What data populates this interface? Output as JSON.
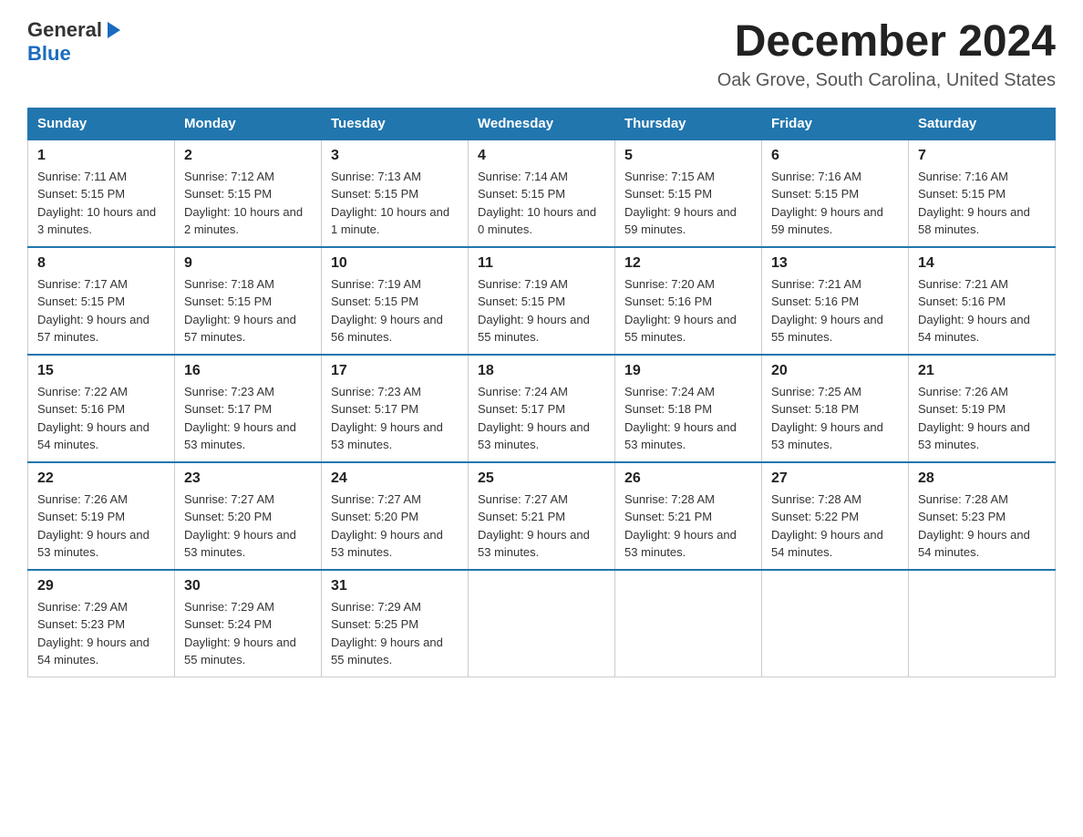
{
  "header": {
    "logo_general": "General",
    "logo_blue": "Blue",
    "month_title": "December 2024",
    "location": "Oak Grove, South Carolina, United States"
  },
  "weekdays": [
    "Sunday",
    "Monday",
    "Tuesday",
    "Wednesday",
    "Thursday",
    "Friday",
    "Saturday"
  ],
  "weeks": [
    [
      {
        "day": "1",
        "sunrise": "7:11 AM",
        "sunset": "5:15 PM",
        "daylight": "10 hours and 3 minutes."
      },
      {
        "day": "2",
        "sunrise": "7:12 AM",
        "sunset": "5:15 PM",
        "daylight": "10 hours and 2 minutes."
      },
      {
        "day": "3",
        "sunrise": "7:13 AM",
        "sunset": "5:15 PM",
        "daylight": "10 hours and 1 minute."
      },
      {
        "day": "4",
        "sunrise": "7:14 AM",
        "sunset": "5:15 PM",
        "daylight": "10 hours and 0 minutes."
      },
      {
        "day": "5",
        "sunrise": "7:15 AM",
        "sunset": "5:15 PM",
        "daylight": "9 hours and 59 minutes."
      },
      {
        "day": "6",
        "sunrise": "7:16 AM",
        "sunset": "5:15 PM",
        "daylight": "9 hours and 59 minutes."
      },
      {
        "day": "7",
        "sunrise": "7:16 AM",
        "sunset": "5:15 PM",
        "daylight": "9 hours and 58 minutes."
      }
    ],
    [
      {
        "day": "8",
        "sunrise": "7:17 AM",
        "sunset": "5:15 PM",
        "daylight": "9 hours and 57 minutes."
      },
      {
        "day": "9",
        "sunrise": "7:18 AM",
        "sunset": "5:15 PM",
        "daylight": "9 hours and 57 minutes."
      },
      {
        "day": "10",
        "sunrise": "7:19 AM",
        "sunset": "5:15 PM",
        "daylight": "9 hours and 56 minutes."
      },
      {
        "day": "11",
        "sunrise": "7:19 AM",
        "sunset": "5:15 PM",
        "daylight": "9 hours and 55 minutes."
      },
      {
        "day": "12",
        "sunrise": "7:20 AM",
        "sunset": "5:16 PM",
        "daylight": "9 hours and 55 minutes."
      },
      {
        "day": "13",
        "sunrise": "7:21 AM",
        "sunset": "5:16 PM",
        "daylight": "9 hours and 55 minutes."
      },
      {
        "day": "14",
        "sunrise": "7:21 AM",
        "sunset": "5:16 PM",
        "daylight": "9 hours and 54 minutes."
      }
    ],
    [
      {
        "day": "15",
        "sunrise": "7:22 AM",
        "sunset": "5:16 PM",
        "daylight": "9 hours and 54 minutes."
      },
      {
        "day": "16",
        "sunrise": "7:23 AM",
        "sunset": "5:17 PM",
        "daylight": "9 hours and 53 minutes."
      },
      {
        "day": "17",
        "sunrise": "7:23 AM",
        "sunset": "5:17 PM",
        "daylight": "9 hours and 53 minutes."
      },
      {
        "day": "18",
        "sunrise": "7:24 AM",
        "sunset": "5:17 PM",
        "daylight": "9 hours and 53 minutes."
      },
      {
        "day": "19",
        "sunrise": "7:24 AM",
        "sunset": "5:18 PM",
        "daylight": "9 hours and 53 minutes."
      },
      {
        "day": "20",
        "sunrise": "7:25 AM",
        "sunset": "5:18 PM",
        "daylight": "9 hours and 53 minutes."
      },
      {
        "day": "21",
        "sunrise": "7:26 AM",
        "sunset": "5:19 PM",
        "daylight": "9 hours and 53 minutes."
      }
    ],
    [
      {
        "day": "22",
        "sunrise": "7:26 AM",
        "sunset": "5:19 PM",
        "daylight": "9 hours and 53 minutes."
      },
      {
        "day": "23",
        "sunrise": "7:27 AM",
        "sunset": "5:20 PM",
        "daylight": "9 hours and 53 minutes."
      },
      {
        "day": "24",
        "sunrise": "7:27 AM",
        "sunset": "5:20 PM",
        "daylight": "9 hours and 53 minutes."
      },
      {
        "day": "25",
        "sunrise": "7:27 AM",
        "sunset": "5:21 PM",
        "daylight": "9 hours and 53 minutes."
      },
      {
        "day": "26",
        "sunrise": "7:28 AM",
        "sunset": "5:21 PM",
        "daylight": "9 hours and 53 minutes."
      },
      {
        "day": "27",
        "sunrise": "7:28 AM",
        "sunset": "5:22 PM",
        "daylight": "9 hours and 54 minutes."
      },
      {
        "day": "28",
        "sunrise": "7:28 AM",
        "sunset": "5:23 PM",
        "daylight": "9 hours and 54 minutes."
      }
    ],
    [
      {
        "day": "29",
        "sunrise": "7:29 AM",
        "sunset": "5:23 PM",
        "daylight": "9 hours and 54 minutes."
      },
      {
        "day": "30",
        "sunrise": "7:29 AM",
        "sunset": "5:24 PM",
        "daylight": "9 hours and 55 minutes."
      },
      {
        "day": "31",
        "sunrise": "7:29 AM",
        "sunset": "5:25 PM",
        "daylight": "9 hours and 55 minutes."
      },
      null,
      null,
      null,
      null
    ]
  ]
}
